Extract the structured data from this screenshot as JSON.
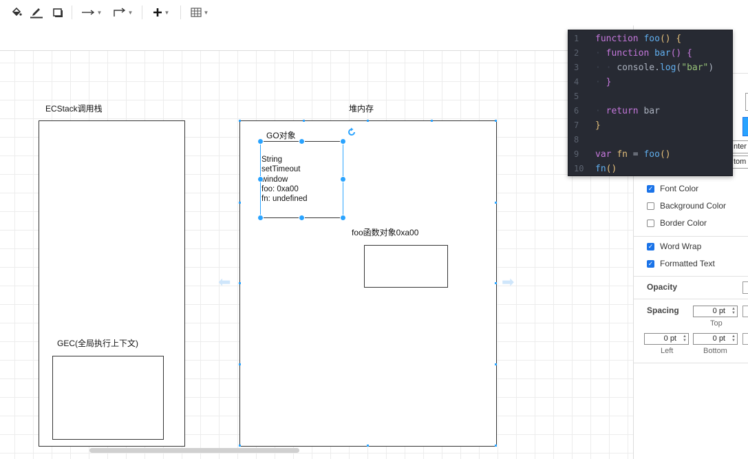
{
  "toolbar": {
    "fill_icon": "paint-bucket-icon",
    "line_color_icon": "pen-line-icon",
    "shadow_icon": "shadow-square-icon",
    "connection_icon": "arrow-right-icon",
    "waypoints_icon": "elbow-connector-icon",
    "insert_icon": "plus-icon",
    "table_icon": "table-grid-icon"
  },
  "diagram": {
    "ecstack_title": "ECStack调用栈",
    "heap_title": "堆内存",
    "go_title": "GO对象",
    "go_lines": [
      "String",
      "setTimeout",
      "window",
      "foo: 0xa00",
      "fn: undefined"
    ],
    "foo_object_title": "foo函数对象0xa00",
    "gec_title": "GEC(全局执行上下文)"
  },
  "code_editor": {
    "lines": [
      {
        "n": "1",
        "text": "function foo() {"
      },
      {
        "n": "2",
        "text": "  function bar() {"
      },
      {
        "n": "3",
        "text": "    console.log(\"bar\")"
      },
      {
        "n": "4",
        "text": "  }"
      },
      {
        "n": "5",
        "text": ""
      },
      {
        "n": "6",
        "text": "  return bar"
      },
      {
        "n": "7",
        "text": "}"
      },
      {
        "n": "8",
        "text": ""
      },
      {
        "n": "9",
        "text": "var fn = foo()"
      },
      {
        "n": "10",
        "text": "fn()"
      }
    ]
  },
  "format_panel": {
    "partial_select_1": "nter",
    "partial_select_2": "tom",
    "checks": [
      {
        "label": "Font Color",
        "checked": true
      },
      {
        "label": "Background Color",
        "checked": false
      },
      {
        "label": "Border Color",
        "checked": false
      },
      {
        "label": "Word Wrap",
        "checked": true
      },
      {
        "label": "Formatted Text",
        "checked": true
      }
    ],
    "opacity_label": "Opacity",
    "spacing_label": "Spacing",
    "spacing_top_value": "0 pt",
    "spacing_top_label": "Top",
    "spacing_left_value": "0 pt",
    "spacing_left_label": "Left",
    "spacing_bottom_value": "0 pt",
    "spacing_bottom_label": "Bottom"
  },
  "colors": {
    "selection_handle": "#29a3ff",
    "checkbox_on": "#1a73e8",
    "editor_bg": "#272a33"
  }
}
